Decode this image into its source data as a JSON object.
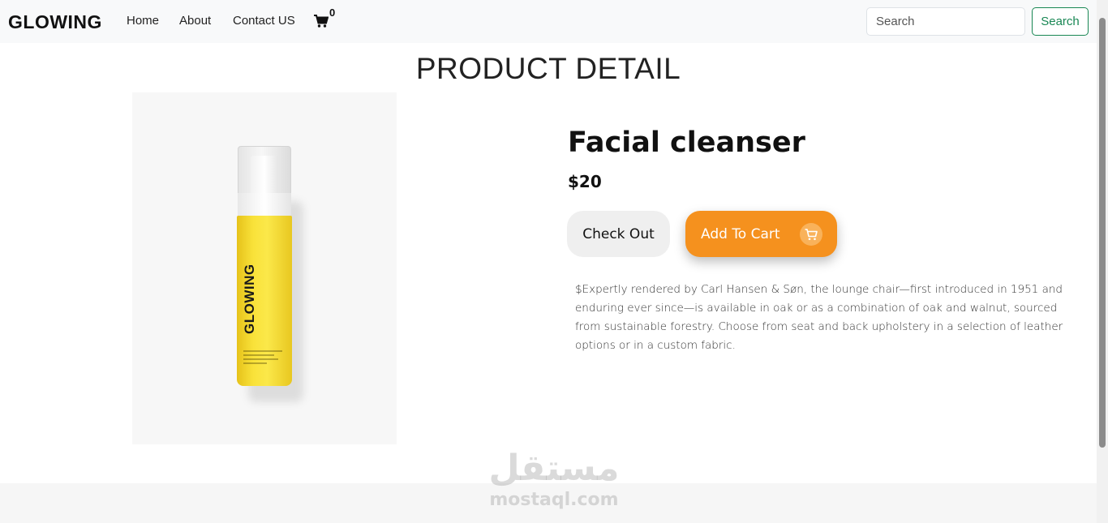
{
  "navbar": {
    "brand": "GLOWING",
    "links": {
      "home": "Home",
      "about": "About",
      "contact": "Contact US"
    },
    "cart_count": "0",
    "search_placeholder": "Search",
    "search_button": "Search"
  },
  "page": {
    "title": "PRODUCT DETAIL"
  },
  "product": {
    "name": "Facial cleanser",
    "price": "$20",
    "image_brand": "GLOWING",
    "checkout_label": "Check Out",
    "add_to_cart_label": "Add To Cart",
    "description": "$Expertly rendered by Carl Hansen & Søn, the lounge chair—first introduced in 1951 and enduring ever since—is available in oak or as a combination of oak and walnut, sourced from sustainable forestry. Choose from seat and back upholstery in a selection of leather options or in a custom fabric."
  },
  "watermark": {
    "arabic": "مستقل",
    "latin": "mostaql.com"
  },
  "colors": {
    "accent_orange": "#f5911e",
    "search_green": "#198754",
    "bottle_yellow": "#f9e23a"
  }
}
